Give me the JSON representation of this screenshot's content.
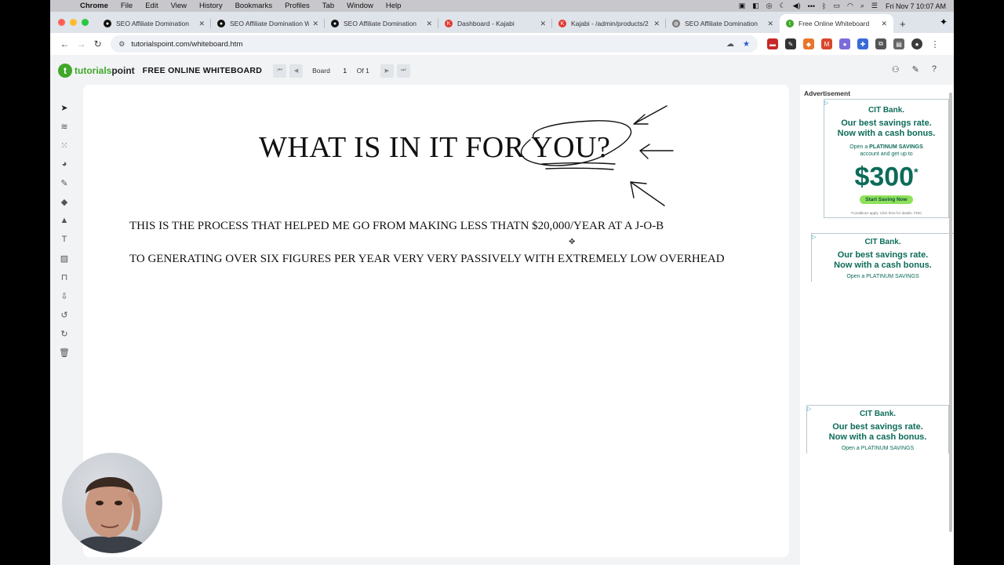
{
  "menubar": {
    "app": "Chrome",
    "items": [
      "File",
      "Edit",
      "View",
      "History",
      "Bookmarks",
      "Profiles",
      "Tab",
      "Window",
      "Help"
    ],
    "clock": "Fri Nov 7  10:07 AM"
  },
  "tabs": [
    {
      "title": "SEO Affiliate Domination",
      "icon": "github-icon",
      "color": "#111111"
    },
    {
      "title": "SEO Affiliate Domination W",
      "icon": "github-icon",
      "color": "#111111"
    },
    {
      "title": "SEO Affiliate Domination",
      "icon": "github-icon",
      "color": "#111111"
    },
    {
      "title": "Dashboard - Kajabi",
      "icon": "kajabi-icon",
      "color": "#e2382f"
    },
    {
      "title": "Kajabi - /admin/products/2",
      "icon": "kajabi-icon",
      "color": "#e2382f"
    },
    {
      "title": "SEO Affiliate Domination",
      "icon": "globe-icon",
      "color": "#666666"
    },
    {
      "title": "Free Online Whiteboard",
      "icon": "tutorialspoint-icon",
      "color": "#40a829"
    }
  ],
  "address": {
    "url": "tutorialspoint.com/whiteboard.htm"
  },
  "app": {
    "logo_text_a": "tutorials",
    "logo_text_b": "point",
    "title": "FREE ONLINE WHITEBOARD",
    "board_label": "Board",
    "board_num": "1",
    "of_label": "Of 1"
  },
  "canvas": {
    "heading": "WHAT IS IN IT FOR YOU?",
    "line1": "THIS IS THE PROCESS THAT HELPED ME GO FROM MAKING LESS THATN $20,000/YEAR AT A J-O-B",
    "line2": "TO GENERATING OVER SIX FIGURES PER YEAR VERY VERY PASSIVELY WITH EXTREMELY LOW OVERHEAD"
  },
  "ads": {
    "label": "Advertisement",
    "brand": "CIT Bank.",
    "headline_1": "Our best savings rate.",
    "headline_2": "Now with a cash bonus.",
    "sub_1": "Open a",
    "sub_bold": "PLATINUM SAVINGS",
    "sub_2": "account and get up to",
    "amount": "$300",
    "amount_sup": "*",
    "cta": "Start Saving Now",
    "fine": "*Conditions apply. Click here for details.",
    "fdic": "FDIC",
    "sub_short": "Open a PLATINUM SAVINGS"
  }
}
